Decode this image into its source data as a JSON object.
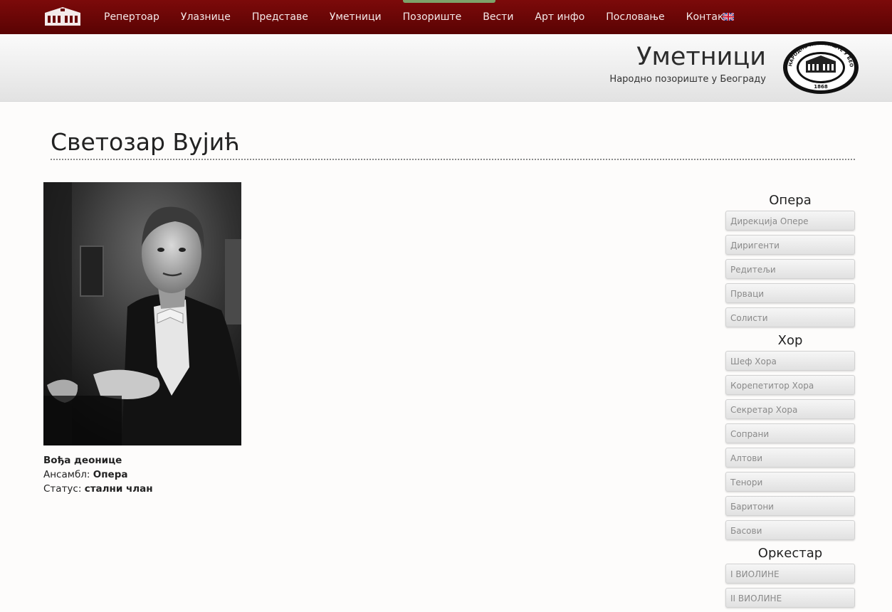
{
  "nav": {
    "items": [
      "Репертоар",
      "Улазнице",
      "Представе",
      "Уметници",
      "Позориште",
      "Вести",
      "Арт инфо",
      "Пословање",
      "Контакт"
    ],
    "flag_icon": "uk-flag-icon"
  },
  "header": {
    "title": "Уметници",
    "subtitle": "Народно позориште у Београду",
    "seal_text": "НАРОДНО ПОЗОРИШТЕ У БЕОГРАДУ",
    "seal_year": "1868"
  },
  "artist": {
    "name": "Светозар Вујић",
    "role": "Вођа деонице",
    "ensemble_label": "Ансамбл:",
    "ensemble_value": "Опера",
    "status_label": "Статус:",
    "status_value": "стални члан"
  },
  "sidebar": {
    "groups": [
      {
        "heading": "Опера",
        "items": [
          "Дирекција Опере",
          "Диригенти",
          "Редитељи",
          "Прваци",
          "Солисти"
        ]
      },
      {
        "heading": "Хор",
        "items": [
          "Шеф Хора",
          "Корепетитор Хора",
          "Секретар Хора",
          "Сопрани",
          "Алтови",
          "Тенори",
          "Баритони",
          "Басови"
        ]
      },
      {
        "heading": "Оркестар",
        "items": [
          "I ВИОЛИНЕ",
          "II ВИОЛИНЕ"
        ]
      }
    ]
  },
  "colors": {
    "nav_bg": "#6b0606",
    "active_strip": "#7da36a"
  }
}
